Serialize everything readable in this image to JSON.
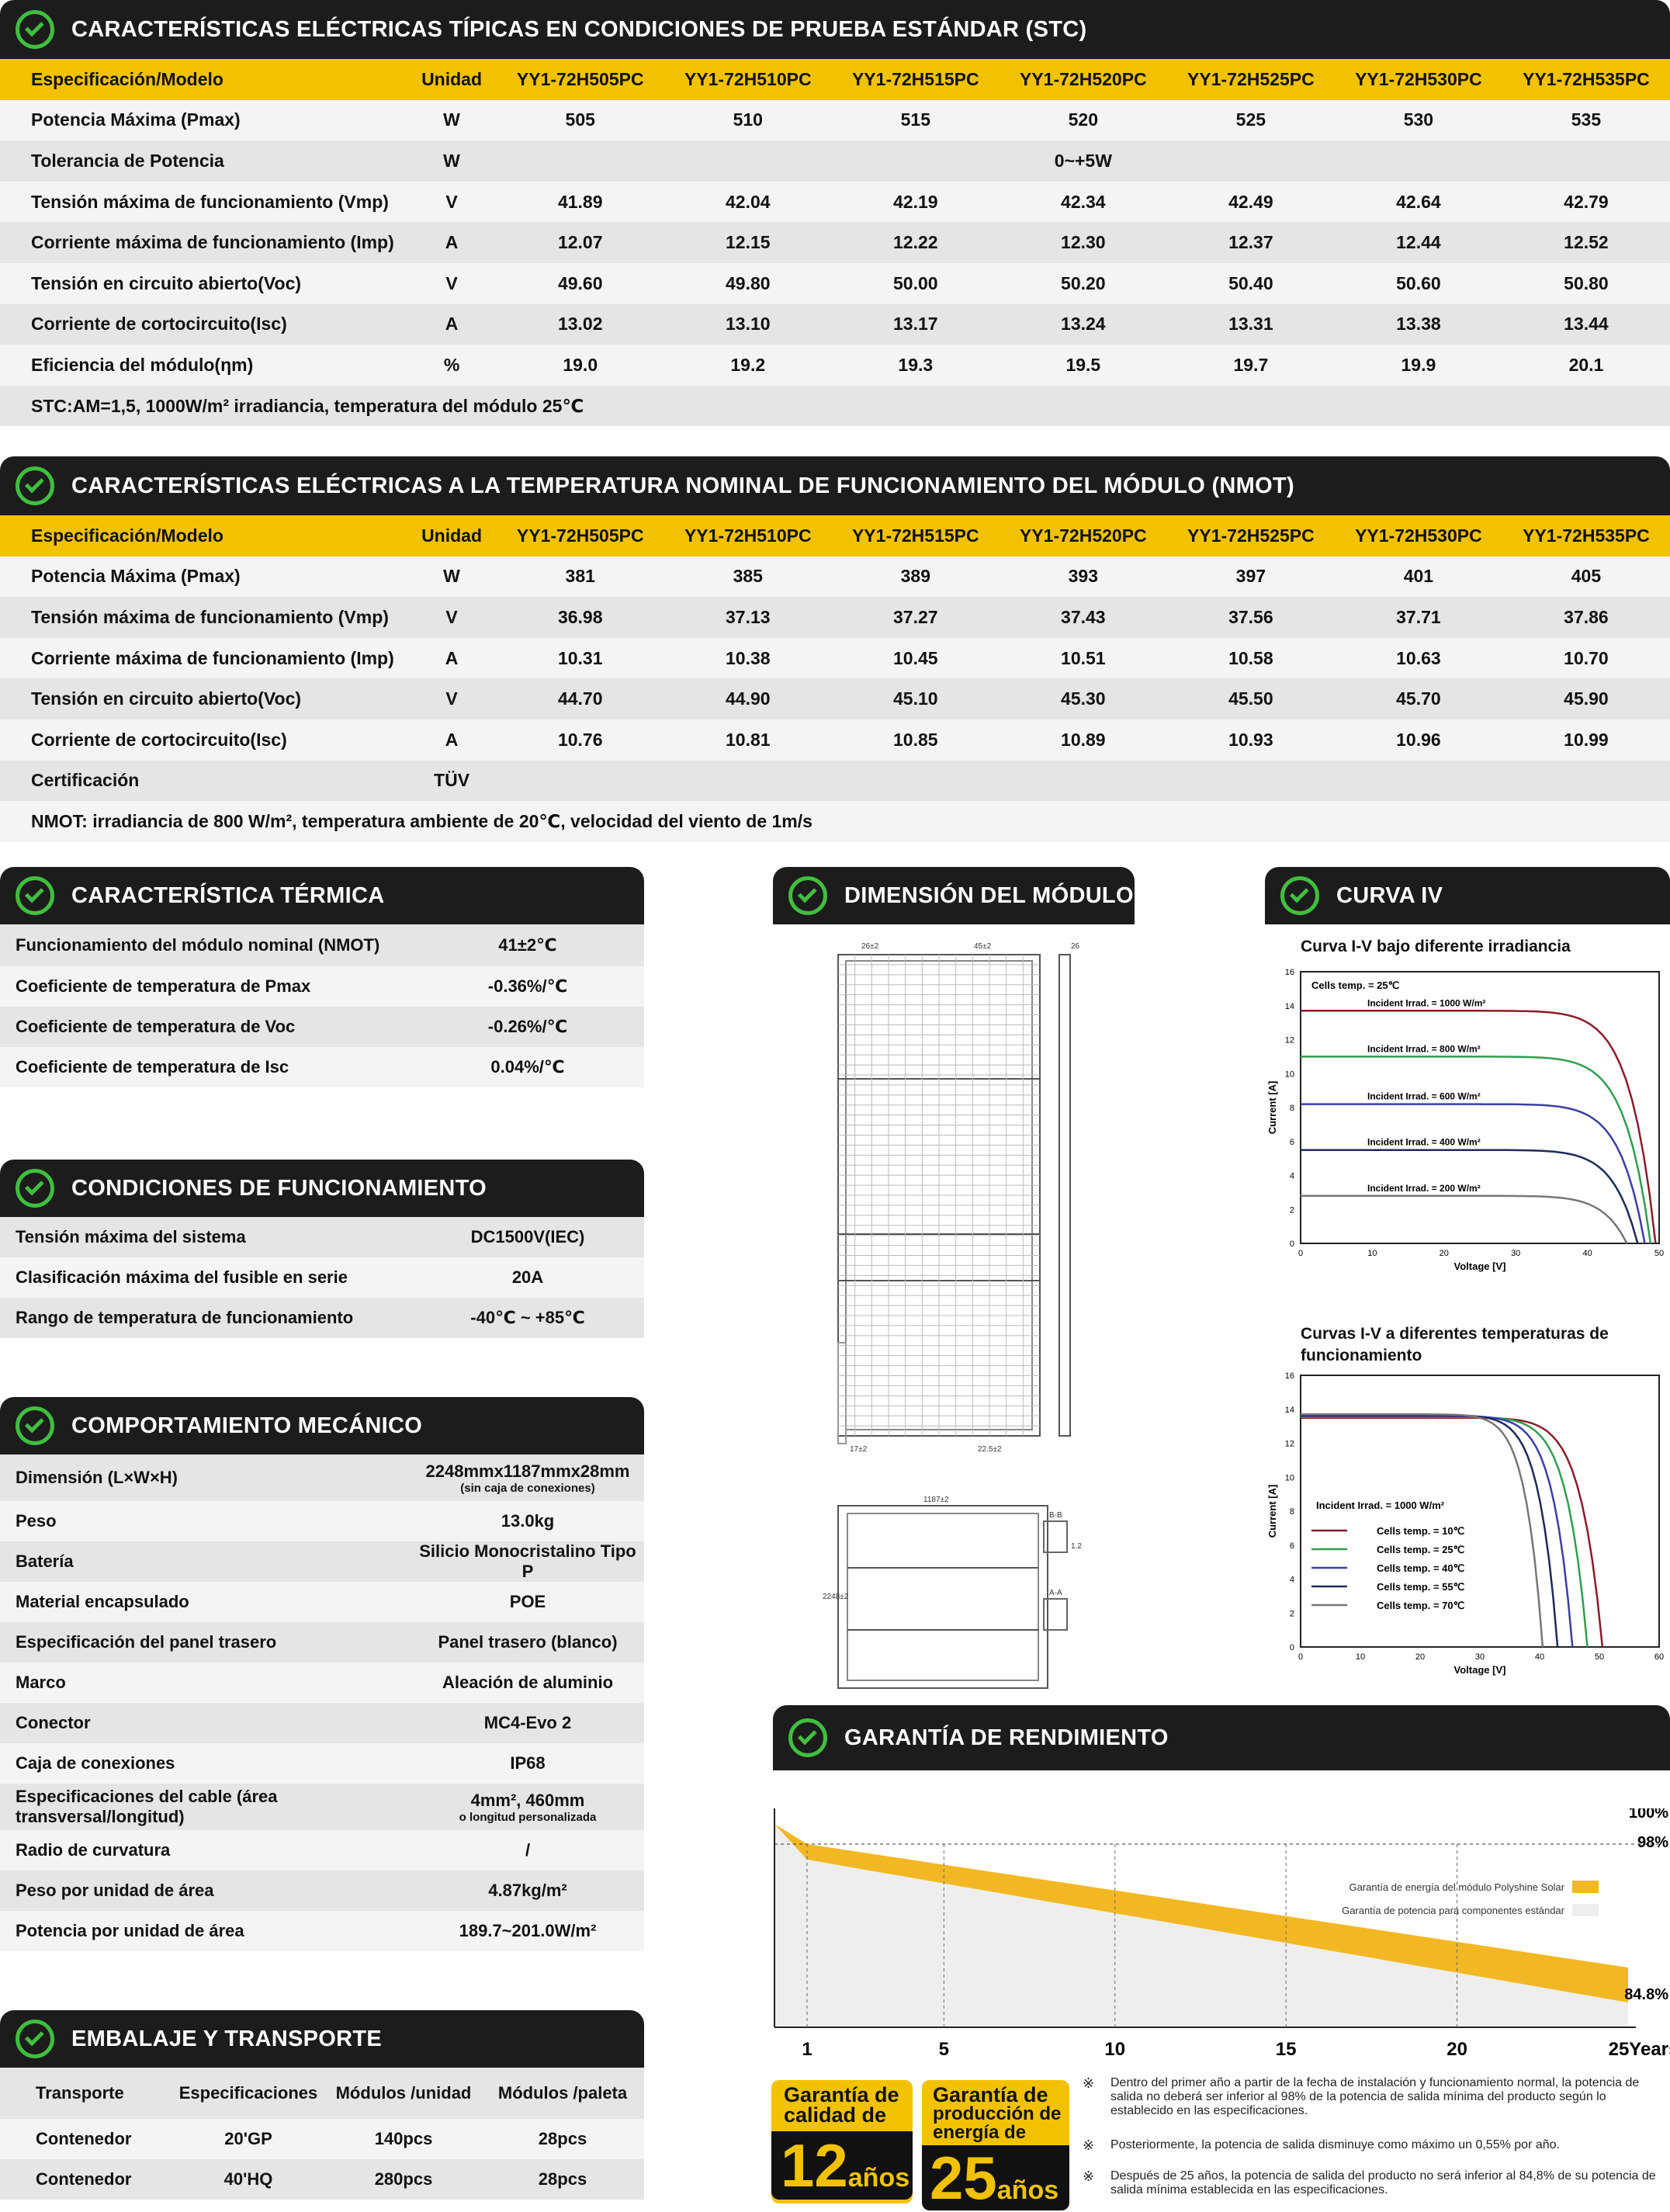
{
  "stc": {
    "title": "CARACTERÍSTICAS ELÉCTRICAS TÍPICAS EN CONDICIONES DE PRUEBA ESTÁNDAR (STC)",
    "head": [
      "Especificación/Modelo",
      "Unidad",
      "YY1-72H505PC",
      "YY1-72H510PC",
      "YY1-72H515PC",
      "YY1-72H520PC",
      "YY1-72H525PC",
      "YY1-72H530PC",
      "YY1-72H535PC"
    ],
    "rows": [
      [
        "Potencia Máxima (Pmax)",
        "W",
        "505",
        "510",
        "515",
        "520",
        "525",
        "530",
        "535"
      ],
      [
        "Tolerancia de Potencia",
        "W",
        "0~+5W"
      ],
      [
        "Tensión máxima de funcionamiento (Vmp)",
        "V",
        "41.89",
        "42.04",
        "42.19",
        "42.34",
        "42.49",
        "42.64",
        "42.79"
      ],
      [
        "Corriente máxima de funcionamiento (Imp)",
        "A",
        "12.07",
        "12.15",
        "12.22",
        "12.30",
        "12.37",
        "12.44",
        "12.52"
      ],
      [
        "Tensión en circuito abierto(Voc)",
        "V",
        "49.60",
        "49.80",
        "50.00",
        "50.20",
        "50.40",
        "50.60",
        "50.80"
      ],
      [
        "Corriente de cortocircuito(Isc)",
        "A",
        "13.02",
        "13.10",
        "13.17",
        "13.24",
        "13.31",
        "13.38",
        "13.44"
      ],
      [
        "Eficiencia del módulo(ηm)",
        "%",
        "19.0",
        "19.2",
        "19.3",
        "19.5",
        "19.7",
        "19.9",
        "20.1"
      ]
    ],
    "note": "STC:AM=1,5, 1000W/m² irradiancia, temperatura del módulo 25℃"
  },
  "nmot": {
    "title": "CARACTERÍSTICAS ELÉCTRICAS A LA TEMPERATURA NOMINAL DE FUNCIONAMIENTO DEL MÓDULO (NMOT)",
    "head": [
      "Especificación/Modelo",
      "Unidad",
      "YY1-72H505PC",
      "YY1-72H510PC",
      "YY1-72H515PC",
      "YY1-72H520PC",
      "YY1-72H525PC",
      "YY1-72H530PC",
      "YY1-72H535PC"
    ],
    "rows": [
      [
        "Potencia Máxima (Pmax)",
        "W",
        "381",
        "385",
        "389",
        "393",
        "397",
        "401",
        "405"
      ],
      [
        "Tensión máxima de funcionamiento (Vmp)",
        "V",
        "36.98",
        "37.13",
        "37.27",
        "37.43",
        "37.56",
        "37.71",
        "37.86"
      ],
      [
        "Corriente máxima de funcionamiento (Imp)",
        "A",
        "10.31",
        "10.38",
        "10.45",
        "10.51",
        "10.58",
        "10.63",
        "10.70"
      ],
      [
        "Tensión en circuito abierto(Voc)",
        "V",
        "44.70",
        "44.90",
        "45.10",
        "45.30",
        "45.50",
        "45.70",
        "45.90"
      ],
      [
        "Corriente de cortocircuito(Isc)",
        "A",
        "10.76",
        "10.81",
        "10.85",
        "10.89",
        "10.93",
        "10.96",
        "10.99"
      ],
      [
        "Certificación",
        "TÜV"
      ]
    ],
    "note": "NMOT: irradiancia de 800 W/m², temperatura ambiente de 20℃, velocidad del viento de 1m/s"
  },
  "thermal": {
    "title": "CARACTERÍSTICA TÉRMICA",
    "rows": [
      [
        "Funcionamiento del módulo nominal (NMOT)",
        "41±2℃"
      ],
      [
        "Coeficiente de temperatura de Pmax",
        "-0.36%/℃"
      ],
      [
        "Coeficiente de temperatura de Voc",
        "-0.26%/℃"
      ],
      [
        "Coeficiente de temperatura de Isc",
        "0.04%/℃"
      ]
    ]
  },
  "operating": {
    "title": "CONDICIONES DE FUNCIONAMIENTO",
    "rows": [
      [
        "Tensión máxima del sistema",
        "DC1500V(IEC)"
      ],
      [
        "Clasificación máxima del fusible en serie",
        "20A"
      ],
      [
        "Rango de temperatura de funcionamiento",
        "-40℃ ~ +85℃"
      ]
    ]
  },
  "mechanical": {
    "title": "COMPORTAMIENTO MECÁNICO",
    "rows": [
      [
        "Dimensión (L×W×H)",
        "2248mmx1187mmx28mm",
        "(sin caja de conexiones)"
      ],
      [
        "Peso",
        "13.0kg",
        ""
      ],
      [
        "Batería",
        "Silicio Monocristalino Tipo P",
        ""
      ],
      [
        "Material encapsulado",
        "POE",
        ""
      ],
      [
        "Especificación del panel trasero",
        "Panel trasero (blanco)",
        ""
      ],
      [
        "Marco",
        "Aleación de aluminio",
        ""
      ],
      [
        "Conector",
        "MC4-Evo 2",
        ""
      ],
      [
        "Caja de conexiones",
        "IP68",
        ""
      ],
      [
        "Especificaciones del cable (área transversal/longitud)",
        "4mm², 460mm",
        "o longitud personalizada"
      ],
      [
        "Radio de curvatura",
        "/",
        ""
      ],
      [
        "Peso por unidad de área",
        "4.87kg/m²",
        ""
      ],
      [
        "Potencia por unidad de área",
        "189.7~201.0W/m²",
        ""
      ]
    ]
  },
  "packing": {
    "title": "EMBALAJE Y TRANSPORTE",
    "head": [
      "Transporte",
      "Especificaciones",
      "Módulos /unidad",
      "Módulos /paleta"
    ],
    "rows": [
      [
        "Contenedor",
        "20'GP",
        "140pcs",
        "28pcs"
      ],
      [
        "Contenedor",
        "40'HQ",
        "280pcs",
        "28pcs"
      ]
    ]
  },
  "dimension": {
    "title": "DIMENSIÓN DEL MÓDULO",
    "labels": [
      "26±2",
      "45±2",
      "26",
      "1187±2",
      "2248±2",
      "17±2",
      "22.5±2",
      "1.2",
      "B-B",
      "A-A"
    ]
  },
  "iv": {
    "title": "CURVA IV",
    "chart_data": [
      {
        "type": "line",
        "title": "Curva I-V bajo diferente irradiancia",
        "xlabel": "Voltage [V]",
        "ylabel": "Current [A]",
        "xlim": [
          0,
          50
        ],
        "ylim": [
          0,
          16
        ],
        "annotation": "Cells temp. = 25℃",
        "series": [
          {
            "name": "Incident Irrad. = 1000 W/m²",
            "isc": 13.7,
            "voc": 49.5,
            "color": "#8a1c2a"
          },
          {
            "name": "Incident Irrad. = 800 W/m²",
            "isc": 11,
            "voc": 48.8,
            "color": "#2e9e4f"
          },
          {
            "name": "Incident Irrad. = 600 W/m²",
            "isc": 8.2,
            "voc": 48,
            "color": "#3b3fa6"
          },
          {
            "name": "Incident Irrad. = 400 W/m²",
            "isc": 5.5,
            "voc": 47,
            "color": "#1e2a5a"
          },
          {
            "name": "Incident Irrad. = 200 W/m²",
            "isc": 2.8,
            "voc": 45.5,
            "color": "#777777"
          }
        ]
      },
      {
        "type": "line",
        "title": "Curvas I-V a diferentes temperaturas de funcionamiento",
        "xlabel": "Voltage [V]",
        "ylabel": "Current [A]",
        "xlim": [
          0,
          60
        ],
        "ylim": [
          0,
          16
        ],
        "annotation": "Incident Irrad. = 1000 W/m²",
        "series": [
          {
            "name": "Cells temp. = 10℃",
            "isc": 13.5,
            "voc": 50.5,
            "color": "#8a1c2a"
          },
          {
            "name": "Cells temp. = 25℃",
            "isc": 13.55,
            "voc": 48,
            "color": "#2e9e4f"
          },
          {
            "name": "Cells temp. = 40℃",
            "isc": 13.6,
            "voc": 45.5,
            "color": "#3b3fa6"
          },
          {
            "name": "Cells temp. = 55℃",
            "isc": 13.65,
            "voc": 43,
            "color": "#1e2a5a"
          },
          {
            "name": "Cells temp. = 70℃",
            "isc": 13.7,
            "voc": 40.5,
            "color": "#777777"
          }
        ]
      }
    ]
  },
  "warranty": {
    "title": "GARANTÍA DE RENDIMIENTO",
    "chart_data": {
      "type": "area",
      "x": [
        0,
        1,
        25
      ],
      "series": [
        {
          "name": "Garantía de energía del módulo Polyshine Solar",
          "color": "#f2b824"
        },
        {
          "name": "Garantía de potencia para componentes estándar",
          "color": "#eeeeee"
        }
      ],
      "xticks": [
        "1",
        "5",
        "10",
        "15",
        "20",
        "25Years"
      ],
      "ylabels": [
        "100%",
        "98%",
        "84.8%"
      ]
    },
    "badges": [
      {
        "line1": "Garantía de",
        "line2": "calidad de",
        "num": "12",
        "unit": "años"
      },
      {
        "line1": "Garantía de",
        "line2": "producción de energía de",
        "num": "25",
        "unit": "años"
      }
    ],
    "notes": [
      "Dentro del primer año a partir de la fecha de instalación y funcionamiento normal, la potencia de salida no deberá ser inferior al 98% de la potencia de salida mínima del producto según lo establecido en las especificaciones.",
      "Posteriormente, la potencia de salida disminuye como máximo un 0,55% por año.",
      "Después de 25 años, la potencia de salida del producto no será inferior al 84,8% de su potencia de salida mínima establecida en las especificaciones."
    ]
  }
}
